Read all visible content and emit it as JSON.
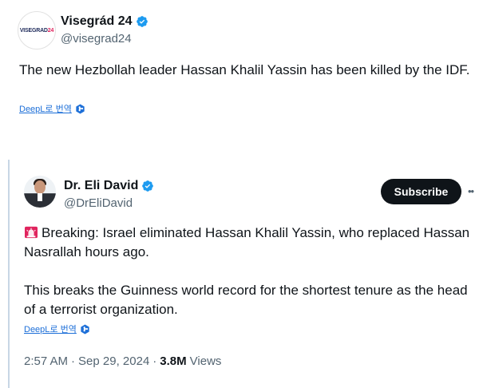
{
  "tweet": {
    "author_name": "Visegrád 24",
    "handle": "@visegrad24",
    "avatar_logo": {
      "primary": "VISEGRAD",
      "accent": "24"
    },
    "text": "The new Hezbollah leader Hassan Khalil Yassin has been killed by the IDF.",
    "translate_label": "DeepL로 번역",
    "more_icon": "ellipsis-icon"
  },
  "quoted": {
    "author_name": "Dr. Eli David",
    "handle": "@DrEliDavid",
    "subscribe_label": "Subscribe",
    "paragraph1": "Breaking: Israel eliminated Hassan Khalil Yassin, who replaced Hassan Nasrallah hours ago.",
    "paragraph2": "This breaks the Guinness world record for the shortest tenure as the head of a terrorist organization.",
    "translate_label": "DeepL로 번역",
    "time": "2:57 AM",
    "date": "Sep 29, 2024",
    "views_count": "3.8M",
    "views_label": "Views",
    "separator": "·"
  },
  "colors": {
    "verified": "#1d9bf0",
    "link": "#1d6fd8",
    "text": "#0f1419",
    "muted": "#536471",
    "subscribe_bg": "#0f1419",
    "quote_bar": "#c8d6e5",
    "siren": "#e0245e"
  }
}
